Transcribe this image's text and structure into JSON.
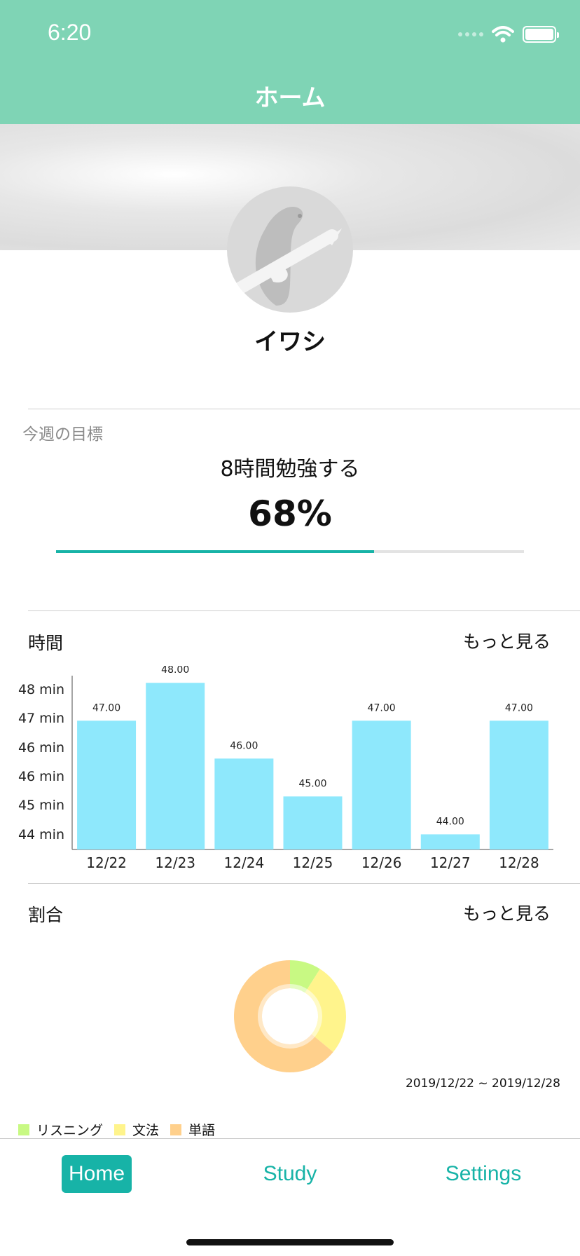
{
  "status_bar": {
    "time": "6:20"
  },
  "header": {
    "title": "ホーム"
  },
  "profile": {
    "name": "イワシ"
  },
  "goal": {
    "label": "今週の目標",
    "text": "8時間勉強する",
    "percent_text": "68%",
    "progress_fraction": 0.68
  },
  "time_section": {
    "title": "時間",
    "more_label": "もっと見る"
  },
  "ratio_section": {
    "title": "割合",
    "more_label": "もっと見る",
    "date_range": "2019/12/22 ~ 2019/12/28"
  },
  "colors": {
    "header": "#7fd4b5",
    "accent": "#17b3a7",
    "bar": "#8ee8fc",
    "listening": "#c8f983",
    "grammar": "#fff48c",
    "vocabulary": "#ffd08c"
  },
  "chart_data": [
    {
      "type": "bar",
      "categories": [
        "12/22",
        "12/23",
        "12/24",
        "12/25",
        "12/26",
        "12/27",
        "12/28"
      ],
      "values": [
        47.0,
        48.0,
        46.0,
        45.0,
        47.0,
        44.0,
        47.0
      ],
      "value_labels": [
        "47.00",
        "48.00",
        "46.00",
        "45.00",
        "47.00",
        "44.00",
        "47.00"
      ],
      "y_tick_labels": [
        "48 min",
        "47 min",
        "46 min",
        "46 min",
        "45 min",
        "44 min"
      ],
      "ylim": [
        43.6,
        48.3
      ],
      "grid": false
    },
    {
      "type": "pie",
      "donut": true,
      "labels": [
        "リスニング",
        "文法",
        "単語"
      ],
      "values": [
        0.09,
        0.27,
        0.64
      ],
      "colors": [
        "#c8f983",
        "#fff48c",
        "#ffd08c"
      ],
      "legend_position": "bottom-left"
    }
  ],
  "tabs": [
    {
      "label": "Home",
      "active": true
    },
    {
      "label": "Study",
      "active": false
    },
    {
      "label": "Settings",
      "active": false
    }
  ]
}
